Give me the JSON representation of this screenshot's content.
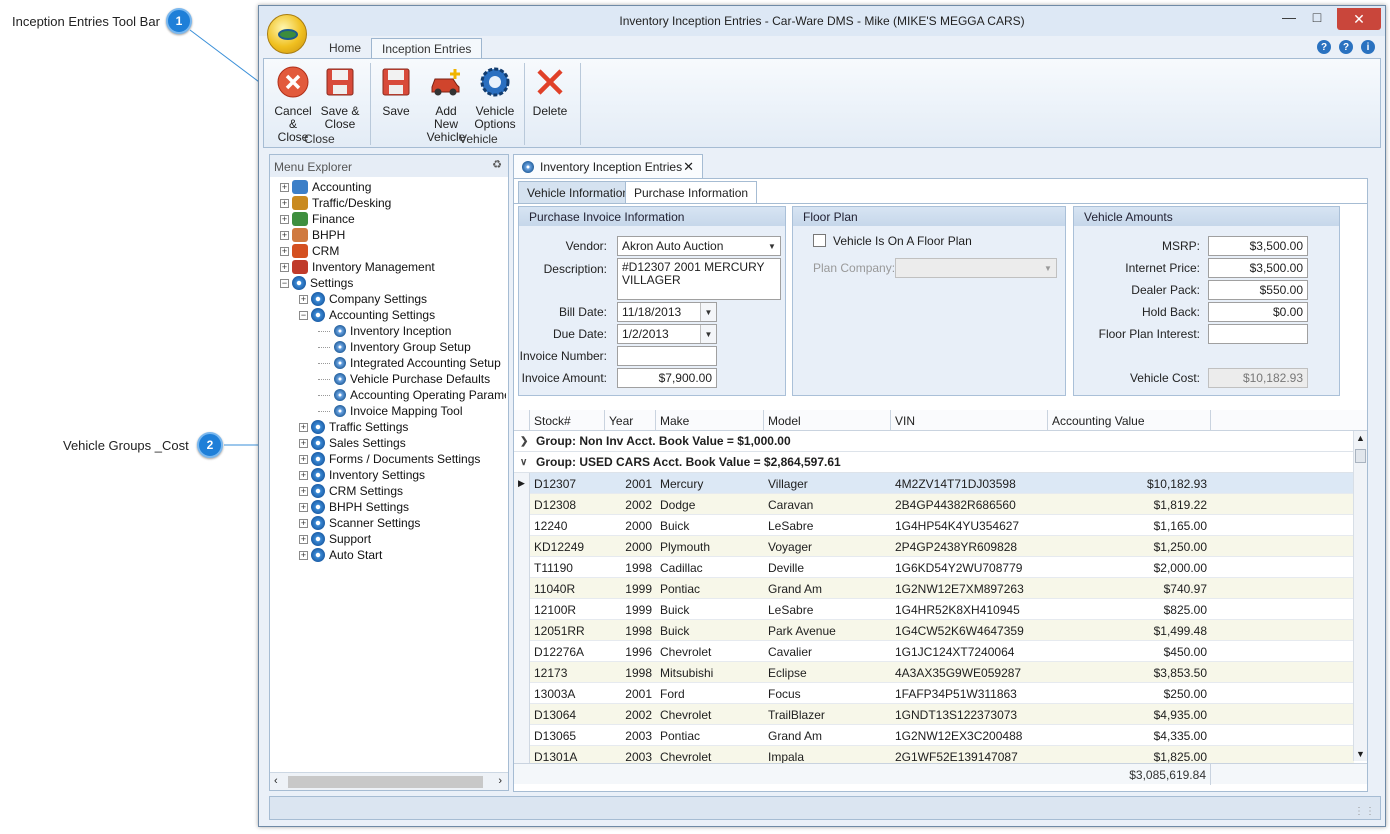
{
  "callouts": [
    {
      "num": "1",
      "label": "Inception Entries Tool Bar"
    },
    {
      "num": "2",
      "label": "Vehicle Groups _Cost"
    }
  ],
  "window": {
    "title": "Inventory Inception Entries - Car-Ware DMS - Mike (MIKE'S MEGGA CARS)"
  },
  "ribbon_tabs": [
    {
      "label": "Home"
    },
    {
      "label": "Inception Entries"
    }
  ],
  "ribbon": {
    "close_group": {
      "label": "Close",
      "cancel_close": "Cancel\n& Close",
      "save_close": "Save &\nClose"
    },
    "vehicle_group": {
      "label": "Vehicle",
      "save": "Save",
      "add_new": "Add New\nVehicle",
      "options": "Vehicle\nOptions",
      "delete": "Delete"
    }
  },
  "menu": {
    "title": "Menu Explorer",
    "items": [
      {
        "label": "Accounting",
        "level": 0
      },
      {
        "label": "Traffic/Desking",
        "level": 0
      },
      {
        "label": "Finance",
        "level": 0
      },
      {
        "label": "BHPH",
        "level": 0
      },
      {
        "label": "CRM",
        "level": 0
      },
      {
        "label": "Inventory Management",
        "level": 0
      },
      {
        "label": "Settings",
        "level": 0
      },
      {
        "label": "Company Settings",
        "level": 1
      },
      {
        "label": "Accounting Settings",
        "level": 1
      },
      {
        "label": "Inventory Inception",
        "level": 2
      },
      {
        "label": "Inventory Group Setup",
        "level": 2
      },
      {
        "label": "Integrated Accounting Setup",
        "level": 2
      },
      {
        "label": "Vehicle Purchase Defaults",
        "level": 2
      },
      {
        "label": "Accounting Operating Parameter",
        "level": 2
      },
      {
        "label": "Invoice Mapping Tool",
        "level": 2
      },
      {
        "label": "Traffic Settings",
        "level": 1
      },
      {
        "label": "Sales Settings",
        "level": 1
      },
      {
        "label": "Forms / Documents Settings",
        "level": 1
      },
      {
        "label": "Inventory Settings",
        "level": 1
      },
      {
        "label": "CRM Settings",
        "level": 1
      },
      {
        "label": "BHPH Settings",
        "level": 1
      },
      {
        "label": "Scanner Settings",
        "level": 1
      },
      {
        "label": "Support",
        "level": 1
      },
      {
        "label": "Auto Start",
        "level": 1
      }
    ]
  },
  "doc_tab": {
    "label": "Inventory Inception Entries"
  },
  "sub_tabs": [
    {
      "label": "Vehicle Information"
    },
    {
      "label": "Purchase Information"
    }
  ],
  "purchase_invoice": {
    "title": "Purchase Invoice Information",
    "vendor_label": "Vendor:",
    "vendor_value": "Akron Auto Auction",
    "description_label": "Description:",
    "description_value": "#D12307 2001 MERCURY VILLAGER",
    "bill_date_label": "Bill Date:",
    "bill_date_value": "11/18/2013",
    "due_date_label": "Due Date:",
    "due_date_value": "1/2/2013",
    "invoice_number_label": "Invoice Number:",
    "invoice_number_value": "",
    "invoice_amount_label": "Invoice Amount:",
    "invoice_amount_value": "$7,900.00"
  },
  "floor_plan": {
    "title": "Floor Plan",
    "checkbox_label": "Vehicle Is On A Floor Plan",
    "checked": false,
    "company_label": "Plan Company:",
    "company_value": ""
  },
  "vehicle_amounts": {
    "title": "Vehicle Amounts",
    "msrp_label": "MSRP:",
    "msrp_value": "$3,500.00",
    "internet_label": "Internet Price:",
    "internet_value": "$3,500.00",
    "pack_label": "Dealer Pack:",
    "pack_value": "$550.00",
    "holdback_label": "Hold Back:",
    "holdback_value": "$0.00",
    "fp_interest_label": "Floor Plan Interest:",
    "fp_interest_value": "",
    "cost_label": "Vehicle Cost:",
    "cost_value": "$10,182.93"
  },
  "grid": {
    "columns": [
      "Stock#",
      "Year",
      "Make",
      "Model",
      "VIN",
      "Accounting Value"
    ],
    "groups": [
      {
        "label": "Group: Non Inv  Acct. Book Value = $1,000.00",
        "expanded": false
      },
      {
        "label": "Group: USED CARS  Acct. Book Value = $2,864,597.61",
        "expanded": true
      }
    ],
    "rows": [
      [
        "D12307",
        "2001",
        "Mercury",
        "Villager",
        "4M2ZV14T71DJ03598",
        "$10,182.93"
      ],
      [
        "D12308",
        "2002",
        "Dodge",
        "Caravan",
        "2B4GP44382R686560",
        "$1,819.22"
      ],
      [
        "12240",
        "2000",
        "Buick",
        "LeSabre",
        "1G4HP54K4YU354627",
        "$1,165.00"
      ],
      [
        "KD12249",
        "2000",
        "Plymouth",
        "Voyager",
        "2P4GP2438YR609828",
        "$1,250.00"
      ],
      [
        "T11190",
        "1998",
        "Cadillac",
        "Deville",
        "1G6KD54Y2WU708779",
        "$2,000.00"
      ],
      [
        "11040R",
        "1999",
        "Pontiac",
        "Grand Am",
        "1G2NW12E7XM897263",
        "$740.97"
      ],
      [
        "12100R",
        "1999",
        "Buick",
        "LeSabre",
        "1G4HR52K8XH410945",
        "$825.00"
      ],
      [
        "12051RR",
        "1998",
        "Buick",
        "Park Avenue",
        "1G4CW52K6W4647359",
        "$1,499.48"
      ],
      [
        "D12276A",
        "1996",
        "Chevrolet",
        "Cavalier",
        "1G1JC124XT7240064",
        "$450.00"
      ],
      [
        "12173",
        "1998",
        "Mitsubishi",
        "Eclipse",
        "4A3AX35G9WE059287",
        "$3,853.50"
      ],
      [
        "13003A",
        "2001",
        "Ford",
        "Focus",
        "1FAFP34P51W311863",
        "$250.00"
      ],
      [
        "D13064",
        "2002",
        "Chevrolet",
        "TrailBlazer",
        "1GNDT13S122373073",
        "$4,935.00"
      ],
      [
        "D13065",
        "2003",
        "Pontiac",
        "Grand Am",
        "1G2NW12EX3C200488",
        "$4,335.00"
      ],
      [
        "D1301A",
        "2003",
        "Chevrolet",
        "Impala",
        "2G1WF52E139147087",
        "$1,825.00"
      ]
    ],
    "total": "$3,085,619.84"
  }
}
